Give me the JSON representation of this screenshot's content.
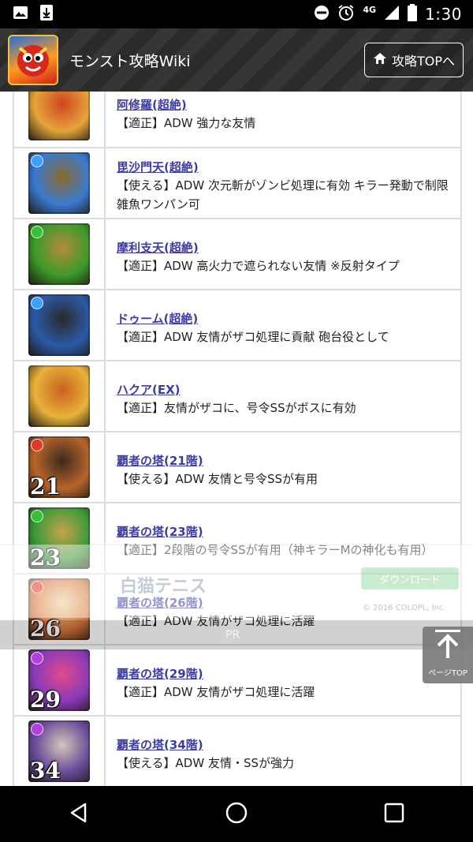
{
  "status_bar": {
    "time": "1:30",
    "network": "4G",
    "icons": [
      "image-icon",
      "download-icon",
      "do-not-disturb-icon",
      "alarm-icon",
      "signal-icon",
      "battery-icon"
    ]
  },
  "header": {
    "title": "モンスト攻略Wiki",
    "top_button_label": "攻略TOPへ",
    "logo_icon": "monster-logo-icon",
    "home_icon": "home-icon"
  },
  "rows": [
    {
      "name": "阿修羅(超絶)",
      "desc": "【適正】ADW 強力な友情",
      "colors": [
        "#e6a53a",
        "#d04420"
      ],
      "element": "",
      "num": ""
    },
    {
      "name": "毘沙門天(超絶)",
      "desc": "【使える】ADW 次元斬がゾンビ処理に有効 キラー発動で制限雑魚ワンパン可",
      "colors": [
        "#3a7ad0",
        "#8a6a2a"
      ],
      "element": "#3aa0ff",
      "num": ""
    },
    {
      "name": "摩利支天(超絶)",
      "desc": "【適正】ADW 高火力で遮られない友情 ※反射タイプ",
      "colors": [
        "#3c9a2a",
        "#b58a3a"
      ],
      "element": "#38c038",
      "num": ""
    },
    {
      "name": "ドゥーム(超絶)",
      "desc": "【適正】ADW 友情がザコ処理に貢献 砲台役として",
      "colors": [
        "#2a5aa8",
        "#2a2a2a"
      ],
      "element": "#3aa0ff",
      "num": ""
    },
    {
      "name": "ハクア(EX)",
      "desc": "【適正】友情がザコに、号令SSがボスに有効",
      "colors": [
        "#e8b23a",
        "#c8621e"
      ],
      "element": "",
      "num": ""
    },
    {
      "name": "覇者の塔(21階)",
      "desc": "【使える】ADW 友情と号令SSが有用",
      "colors": [
        "#b8642a",
        "#3a2a1e"
      ],
      "element": "#e03a2a",
      "num": "21"
    },
    {
      "name": "覇者の塔(23階)",
      "desc": "【適正】2段階の号令SSが有用（神キラーMの神化も有用）",
      "colors": [
        "#3a9a3a",
        "#c8a24a"
      ],
      "element": "#38c038",
      "num": "23"
    },
    {
      "name": "覇者の塔(26階)",
      "desc": "【適正】ADW 友情がザコ処理に活躍",
      "colors": [
        "#d8763a",
        "#f0d0a0"
      ],
      "element": "#e03a2a",
      "num": "26"
    },
    {
      "name": "覇者の塔(29階)",
      "desc": "【適正】ADW 友情がザコ処理に活躍",
      "colors": [
        "#8a3ab8",
        "#e04a8a"
      ],
      "element": "#b040e0",
      "num": "29"
    },
    {
      "name": "覇者の塔(34階)",
      "desc": "【使える】ADW 友情・SSが強力",
      "colors": [
        "#6a4a9a",
        "#d0c8b8"
      ],
      "element": "#b040e0",
      "num": "34"
    }
  ],
  "ad": {
    "title": "白猫テニス",
    "download_label": "ダウンロード",
    "copyright": "© 2016 COLOPL, Inc.",
    "pr_label": "PR"
  },
  "page_top": {
    "label": "ページTOP",
    "icon": "arrow-up-icon"
  },
  "nav": {
    "icons": [
      "back-icon",
      "home-circle-icon",
      "recents-icon"
    ]
  }
}
